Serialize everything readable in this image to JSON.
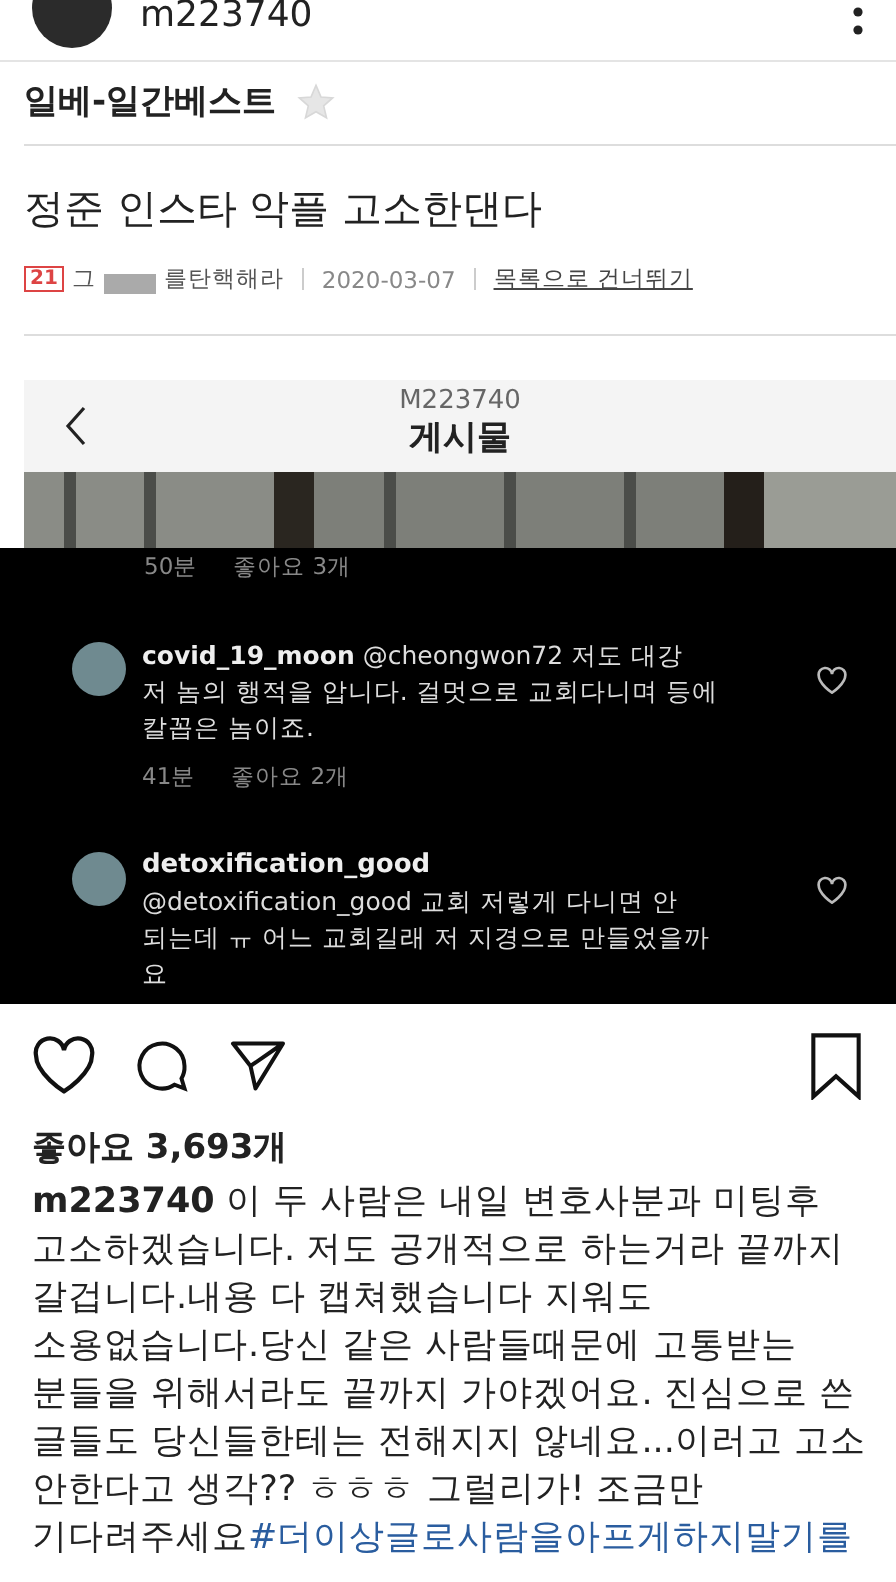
{
  "profile": {
    "username": "m223740"
  },
  "board": {
    "name": "일베-일간베스트",
    "favorited": false
  },
  "post": {
    "title": "정준 인스타 악플 고소한댄다",
    "level": "21",
    "author_start": "그",
    "author_end": "를탄핵해라",
    "date": "2020-03-07",
    "skip_link": "목록으로 건너뛰기"
  },
  "embedded": {
    "header_user": "M223740",
    "header_title": "게시물",
    "prev_time": "50분",
    "prev_likes": "좋아요 3개",
    "comments": [
      {
        "kind": "inline",
        "username": "covid_19_moon",
        "lines": [
          "@cheongwon72 저도 대강",
          "저 놈의 행적을 압니다. 걸멋으로 교회다니며 등에",
          "칼꼽은 놈이죠."
        ],
        "time": "41분",
        "likes": "좋아요 2개"
      },
      {
        "kind": "block",
        "username": "detoxification_good",
        "lines": [
          "@detoxification_good 교회 저렇게 다니면 안",
          "되는데 ㅠ 어느 교회길래 저 지경으로 만들었을까",
          "요"
        ]
      }
    ]
  },
  "likes": "좋아요 3,693개",
  "caption": {
    "username": "m223740",
    "lines": [
      "이 두 사람은 내일 변호사분과 미팅후",
      "고소하겠습니다. 저도 공개적으로 하는거라 끝까지",
      "갈겁니다.내용 다 캡쳐했습니다 지워도",
      "소용없습니다.당신 같은 사람들때문에 고통받는",
      "분들을 위해서라도 끝까지 가야겠어요. 진심으로 쓴",
      "글들도 당신들한테는 전해지지 않네요...이러고 고소",
      "안한다고 생각?? ㅎㅎㅎ 그럴리가! 조금만",
      "기다려주세요"
    ],
    "hashtag": "#더이상글로사람을아프게하지말기를"
  }
}
